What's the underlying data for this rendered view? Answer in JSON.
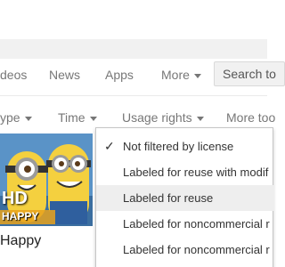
{
  "nav": {
    "tabs": [
      {
        "label": "deos"
      },
      {
        "label": "News"
      },
      {
        "label": "Apps"
      },
      {
        "label": "More"
      }
    ],
    "search_tools_label": "Search to"
  },
  "tools": {
    "items": [
      {
        "label": "ype"
      },
      {
        "label": "Time"
      },
      {
        "label": "Usage rights"
      },
      {
        "label": "More too"
      }
    ]
  },
  "usage_menu": {
    "items": [
      {
        "label": "Not filtered by license",
        "checked": true
      },
      {
        "label": "Labeled for reuse with modif",
        "checked": false
      },
      {
        "label": "Labeled for reuse",
        "checked": false
      },
      {
        "label": "Labeled for noncommercial r",
        "checked": false
      },
      {
        "label": "Labeled for noncommercial r",
        "checked": false
      }
    ]
  },
  "result": {
    "badge_hd": "HD",
    "badge_text": "HAPPY",
    "caption": "Happy"
  },
  "colors": {
    "accent_gray": "#777777",
    "menu_highlight": "#eeeeee",
    "thumb_sky": "#5a93c7",
    "minion_yellow": "#f4d03f"
  }
}
